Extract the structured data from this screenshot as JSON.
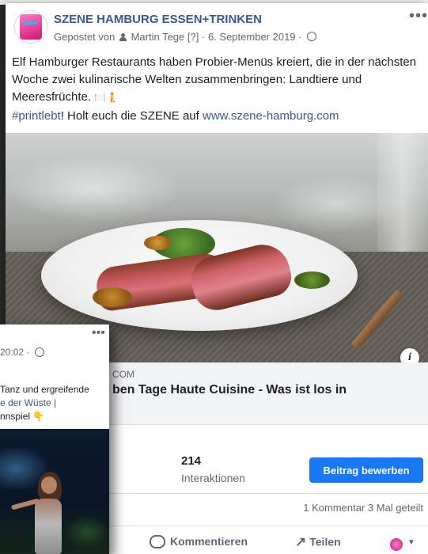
{
  "post": {
    "page_name": "SZENE HAMBURG ESSEN+TRINKEN",
    "posted_by_prefix": "Gepostet von",
    "author": "Martin Tege",
    "author_flag": "[?]",
    "separator": "·",
    "date": "6. September 2019 ·",
    "more_label": "•••",
    "text_main": "Elf Hamburger Restaurants haben Probier-Menüs kreiert, die in der nächsten Woche zwei kulinarische Welten zusammenbringen: Landtiere und Meeresfrüchte.",
    "text_emoji": "🍽️🧜",
    "hashtag": "#printlebt",
    "cta_text": "! Holt euch die SZENE auf",
    "url": "www.szene-hamburg.com"
  },
  "photo": {
    "info_label": "i"
  },
  "link_preview": {
    "domain_fragment": "COM",
    "title_fragment": "ben Tage Haute Cuisine - Was ist los in"
  },
  "stats": {
    "interactions_count": "214",
    "interactions_label": "Interaktionen",
    "boost_label": "Beitrag bewerben",
    "comments": "1 Kommentar",
    "shares": "3 Mal geteilt"
  },
  "actions": {
    "comment_label": "Kommentieren",
    "share_label": "Teilen",
    "share_icon": "↗",
    "caret": "▼"
  },
  "overlap_post": {
    "more_label": "•••",
    "meta_fragment": "20:02 ·",
    "line1": "Tanz und ergreifende",
    "line2": "e der Wüste |",
    "line3": "nnspiel 👇"
  },
  "colors": {
    "brand_blue": "#385898",
    "button_blue": "#1877f2",
    "meta_gray": "#616770"
  }
}
